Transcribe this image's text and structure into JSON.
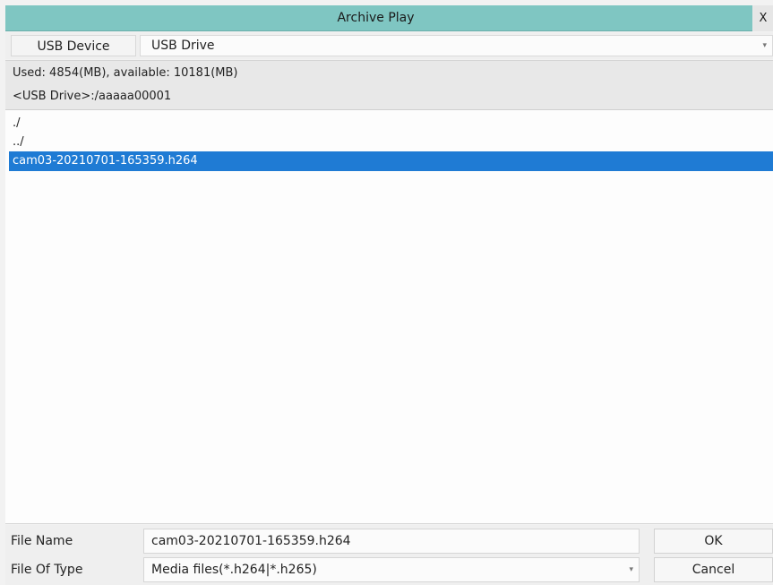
{
  "window": {
    "title": "Archive Play",
    "close_label": "X"
  },
  "device": {
    "label": "USB Device",
    "selected": "USB Drive",
    "arrow": "▾"
  },
  "info": {
    "usage": "Used: 4854(MB), available: 10181(MB)",
    "path": "<USB Drive>:/aaaaa00001"
  },
  "files": [
    {
      "name": "./",
      "selected": false
    },
    {
      "name": "../",
      "selected": false
    },
    {
      "name": "cam03-20210701-165359.h264",
      "selected": true
    }
  ],
  "bottom": {
    "file_name_label": "File Name",
    "file_name_value": "cam03-20210701-165359.h264",
    "file_type_label": "File Of Type",
    "file_type_value": "Media files(*.h264|*.h265)",
    "file_type_arrow": "▾",
    "ok_label": "OK",
    "cancel_label": "Cancel"
  },
  "colors": {
    "titlebar": "#7fc6c2",
    "selection": "#1f7bd4"
  }
}
